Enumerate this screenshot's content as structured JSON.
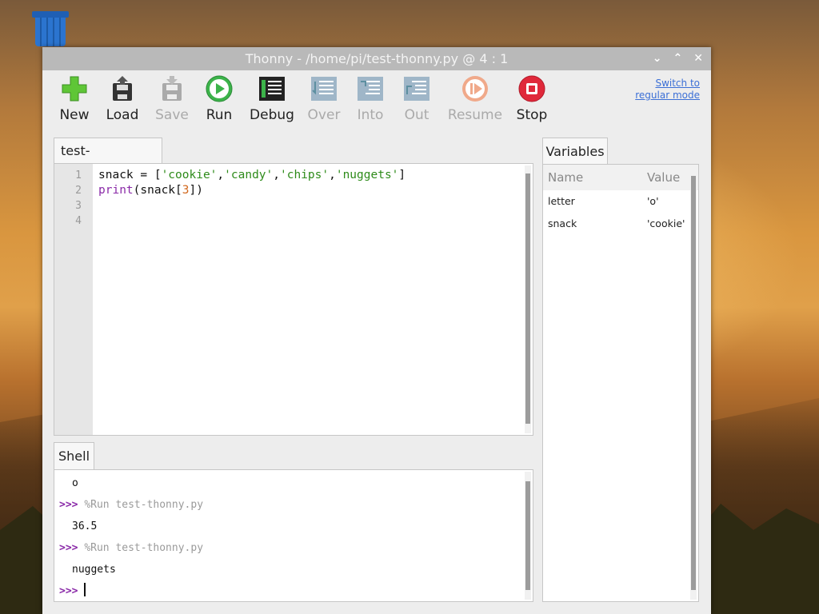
{
  "window": {
    "title": "Thonny  -  /home/pi/test-thonny.py  @  4 : 1"
  },
  "toolbar": {
    "buttons": [
      {
        "label": "New",
        "icon": "new-icon",
        "enabled": true
      },
      {
        "label": "Load",
        "icon": "load-icon",
        "enabled": true
      },
      {
        "label": "Save",
        "icon": "save-icon",
        "enabled": false
      },
      {
        "label": "Run",
        "icon": "run-icon",
        "enabled": true
      },
      {
        "label": "Debug",
        "icon": "debug-icon",
        "enabled": true
      },
      {
        "label": "Over",
        "icon": "step-over-icon",
        "enabled": false
      },
      {
        "label": "Into",
        "icon": "step-into-icon",
        "enabled": false
      },
      {
        "label": "Out",
        "icon": "step-out-icon",
        "enabled": false
      },
      {
        "label": "Resume",
        "icon": "resume-icon",
        "enabled": false
      },
      {
        "label": "Stop",
        "icon": "stop-icon",
        "enabled": true
      }
    ],
    "switch_mode_line1": "Switch to",
    "switch_mode_line2": "regular mode"
  },
  "editor": {
    "tab_label": "test-thonny.py",
    "line_numbers": [
      "1",
      "2",
      "3",
      "4"
    ],
    "code_line1": {
      "var": "snack",
      "op": " = [",
      "s1": "'cookie'",
      "s2": "'candy'",
      "s3": "'chips'",
      "s4": "'nuggets'",
      "comma": ",",
      "close": "]"
    },
    "code_line2": {
      "fn": "print",
      "open": "(snack[",
      "idx": "3",
      "close": "])"
    }
  },
  "shell": {
    "tab_label": "Shell",
    "prompt": ">>>",
    "output1": "o",
    "command1": "%Run test-thonny.py",
    "output2": "36.5",
    "command2": "%Run test-thonny.py",
    "output3": "nuggets"
  },
  "variables": {
    "tab_label": "Variables",
    "col_name": "Name",
    "col_value": "Value",
    "rows": [
      {
        "name": "letter",
        "value": "'o'"
      },
      {
        "name": "snack",
        "value": "'cookie'"
      }
    ]
  },
  "colors": {
    "string": "#2e8b1a",
    "keyword": "#8a2aa8",
    "number": "#d2691e",
    "link": "#3b6fd6"
  }
}
